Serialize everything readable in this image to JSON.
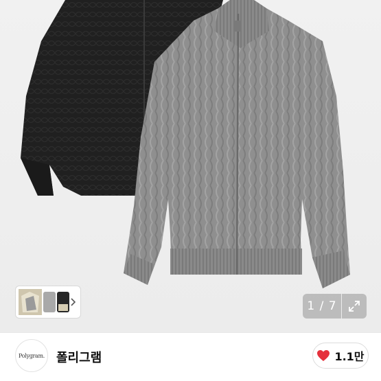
{
  "gallery": {
    "page_current": "1",
    "page_separator": " / ",
    "page_total": "7",
    "thumbnail_icon": "chevron-right-icon",
    "expand_icon": "expand-arrows-icon"
  },
  "shop": {
    "logo_text": "Polygram.",
    "name": "폴리그램",
    "like_icon": "heart-icon",
    "like_color": "#e5313c",
    "like_count": "1.1만"
  }
}
